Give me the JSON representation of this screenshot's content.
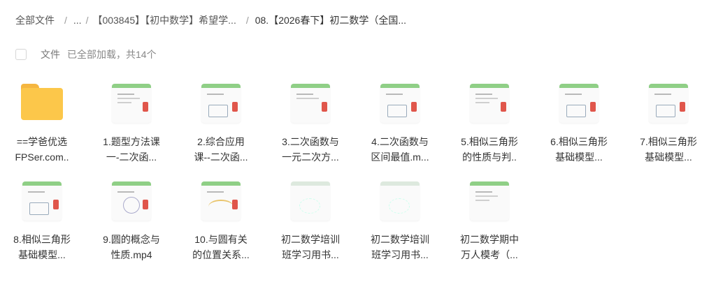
{
  "breadcrumb": {
    "root": "全部文件",
    "ellipsis": "...",
    "level2": "【003845】【初中数学】希望学...",
    "current": "08.【2026春下】初二数学（全国..."
  },
  "header": {
    "file_label": "文件",
    "count_text": "已全部加载，共14个"
  },
  "files": [
    {
      "line1": "==学爸优选",
      "line2": "FPSer.com..",
      "type": "folder"
    },
    {
      "line1": "1.题型方法课",
      "line2": "一-二次函...",
      "type": "video"
    },
    {
      "line1": "2.综合应用",
      "line2": "课--二次函...",
      "type": "video"
    },
    {
      "line1": "3.二次函数与",
      "line2": "一元二次方...",
      "type": "video"
    },
    {
      "line1": "4.二次函数与",
      "line2": "区间最值.m...",
      "type": "video"
    },
    {
      "line1": "5.相似三角形",
      "line2": "的性质与判..",
      "type": "video"
    },
    {
      "line1": "6.相似三角形",
      "line2": "基础模型...",
      "type": "video"
    },
    {
      "line1": "7.相似三角形",
      "line2": "基础模型...",
      "type": "video"
    },
    {
      "line1": "8.相似三角形",
      "line2": "基础模型...",
      "type": "video"
    },
    {
      "line1": "9.圆的概念与",
      "line2": "性质.mp4",
      "type": "video"
    },
    {
      "line1": "10.与圆有关",
      "line2": "的位置关系...",
      "type": "video"
    },
    {
      "line1": "初二数学培训",
      "line2": "班学习用书...",
      "type": "doc"
    },
    {
      "line1": "初二数学培训",
      "line2": "班学习用书...",
      "type": "doc"
    },
    {
      "line1": "初二数学期中",
      "line2": "万人模考（...",
      "type": "doc"
    }
  ]
}
